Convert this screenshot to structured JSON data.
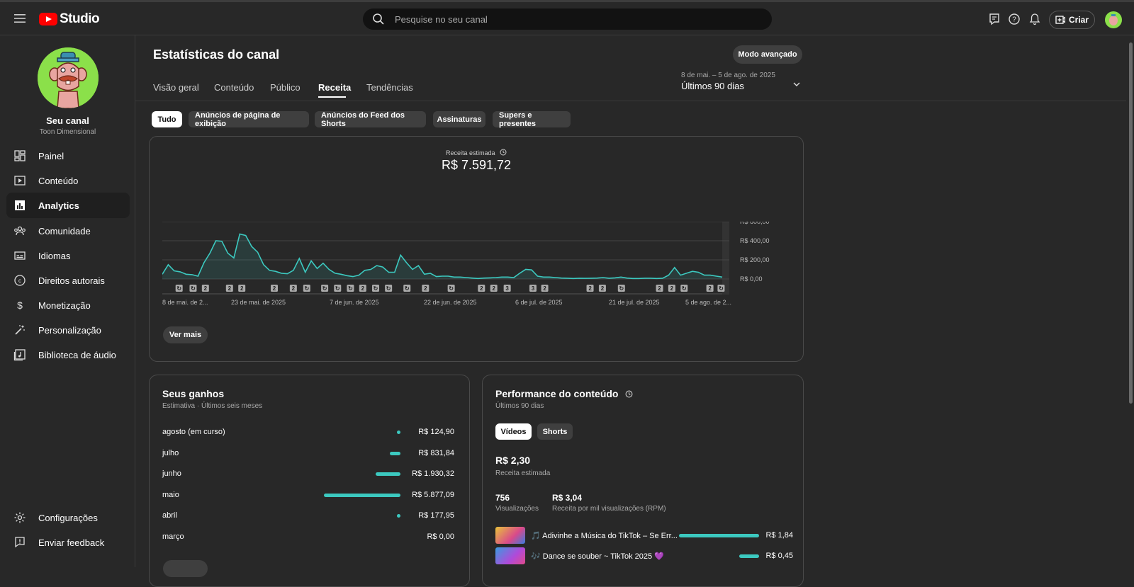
{
  "header": {
    "logo_text": "Studio",
    "search_placeholder": "Pesquise no seu canal",
    "create_label": "Criar",
    "icons": [
      "menu-icon",
      "subtitles-icon",
      "help-icon",
      "bell-icon",
      "create-icon"
    ]
  },
  "channel": {
    "name": "Seu canal",
    "handle": "Toon Dimensional"
  },
  "sidebar": {
    "items": [
      {
        "label": "Painel",
        "icon": "dashboard-icon"
      },
      {
        "label": "Conteúdo",
        "icon": "content-icon"
      },
      {
        "label": "Analytics",
        "icon": "analytics-icon",
        "active": true
      },
      {
        "label": "Comunidade",
        "icon": "community-icon"
      },
      {
        "label": "Idiomas",
        "icon": "subtitles-icon"
      },
      {
        "label": "Direitos autorais",
        "icon": "copyright-icon"
      },
      {
        "label": "Monetização",
        "icon": "dollar-icon"
      },
      {
        "label": "Personalização",
        "icon": "magic-wand-icon"
      },
      {
        "label": "Biblioteca de áudio",
        "icon": "audio-library-icon"
      }
    ],
    "bottom_items": [
      {
        "label": "Configurações",
        "icon": "gear-icon"
      },
      {
        "label": "Enviar feedback",
        "icon": "feedback-icon"
      }
    ]
  },
  "page": {
    "title": "Estatísticas do canal",
    "advanced_button": "Modo avançado",
    "tabs": [
      "Visão geral",
      "Conteúdo",
      "Público",
      "Receita",
      "Tendências"
    ],
    "active_tab": "Receita",
    "date_range": "8 de mai. – 5 de ago. de 2025",
    "date_label": "Últimos 90 dias"
  },
  "filters": [
    "Tudo",
    "Anúncios de página de exibição",
    "Anúncios do Feed dos Shorts",
    "Assinaturas",
    "Supers e presentes"
  ],
  "revenue": {
    "label": "Receita estimada",
    "value": "R$ 7.591,72",
    "see_more": "Ver mais"
  },
  "chart_data": {
    "type": "area",
    "y_tick_labels": [
      "R$ 600,00",
      "R$ 400,00",
      "R$ 200,00",
      "R$ 0,00"
    ],
    "ylim": [
      0,
      600
    ],
    "x_tick_labels": [
      "8 de mai. de 2...",
      "23 de mai. de 2025",
      "7 de jun. de 2025",
      "22 de jun. de 2025",
      "6 de jul. de 2025",
      "21 de jul. de 2025",
      "5 de ago. de 2..."
    ],
    "values": [
      50,
      150,
      85,
      75,
      50,
      45,
      30,
      170,
      270,
      400,
      395,
      270,
      220,
      470,
      455,
      340,
      280,
      150,
      90,
      80,
      60,
      55,
      90,
      215,
      70,
      190,
      110,
      165,
      100,
      60,
      50,
      35,
      25,
      40,
      90,
      100,
      140,
      125,
      70,
      70,
      250,
      170,
      100,
      140,
      50,
      60,
      25,
      30,
      30,
      20,
      20,
      15,
      10,
      5,
      10,
      12,
      15,
      20,
      20,
      15,
      60,
      100,
      95,
      30,
      20,
      20,
      15,
      10,
      8,
      5,
      8,
      7,
      8,
      10,
      15,
      8,
      12,
      20,
      10,
      5,
      5,
      8,
      8,
      5,
      8,
      40,
      120,
      40,
      60,
      80,
      70,
      40,
      40,
      30,
      20
    ],
    "series_color": "#3cc9c0",
    "markers": [
      {
        "x": 0.03,
        "label": "↻"
      },
      {
        "x": 0.055,
        "label": "↻"
      },
      {
        "x": 0.077,
        "label": "2"
      },
      {
        "x": 0.12,
        "label": "2"
      },
      {
        "x": 0.142,
        "label": "2"
      },
      {
        "x": 0.2,
        "label": "2"
      },
      {
        "x": 0.234,
        "label": "2"
      },
      {
        "x": 0.258,
        "label": "↻"
      },
      {
        "x": 0.29,
        "label": "↻"
      },
      {
        "x": 0.313,
        "label": "↻"
      },
      {
        "x": 0.336,
        "label": "↻"
      },
      {
        "x": 0.358,
        "label": "2"
      },
      {
        "x": 0.381,
        "label": "↻"
      },
      {
        "x": 0.404,
        "label": "↻"
      },
      {
        "x": 0.437,
        "label": "↻"
      },
      {
        "x": 0.47,
        "label": "2"
      },
      {
        "x": 0.516,
        "label": "↻"
      },
      {
        "x": 0.57,
        "label": "2"
      },
      {
        "x": 0.592,
        "label": "2"
      },
      {
        "x": 0.616,
        "label": "3"
      },
      {
        "x": 0.662,
        "label": "3"
      },
      {
        "x": 0.683,
        "label": "2"
      },
      {
        "x": 0.764,
        "label": "2"
      },
      {
        "x": 0.786,
        "label": "2"
      },
      {
        "x": 0.82,
        "label": "↻"
      },
      {
        "x": 0.888,
        "label": "2"
      },
      {
        "x": 0.91,
        "label": "2"
      },
      {
        "x": 0.932,
        "label": "↻"
      },
      {
        "x": 0.978,
        "label": "2"
      },
      {
        "x": 0.998,
        "label": "↻"
      }
    ]
  },
  "earnings": {
    "title": "Seus ganhos",
    "subtitle": "Estimativa · Últimos seis meses",
    "rows": [
      {
        "month": "agosto (em curso)",
        "value": "R$ 124,90",
        "amount": 124.9
      },
      {
        "month": "julho",
        "value": "R$ 831,84",
        "amount": 831.84
      },
      {
        "month": "junho",
        "value": "R$ 1.930,32",
        "amount": 1930.32
      },
      {
        "month": "maio",
        "value": "R$ 5.877,09",
        "amount": 5877.09
      },
      {
        "month": "abril",
        "value": "R$ 177,95",
        "amount": 177.95
      },
      {
        "month": "março",
        "value": "R$ 0,00",
        "amount": 0
      }
    ]
  },
  "performance": {
    "title": "Performance do conteúdo",
    "subtitle": "Últimos 90 dias",
    "toggles": [
      "Vídeos",
      "Shorts"
    ],
    "revenue": "R$ 2,30",
    "revenue_label": "Receita estimada",
    "views": "756",
    "views_label": "Visualizações",
    "rpm": "R$ 3,04",
    "rpm_label": "Receita por mil visualizações (RPM)",
    "videos": [
      {
        "title": "🎵 Adivinhe a Música do TikTok – Se Err...",
        "value": "R$ 1,84",
        "amount": 1.84
      },
      {
        "title": "🎶 Dance se souber ~ TikTok 2025 💜",
        "value": "R$ 0,45",
        "amount": 0.45
      }
    ]
  }
}
